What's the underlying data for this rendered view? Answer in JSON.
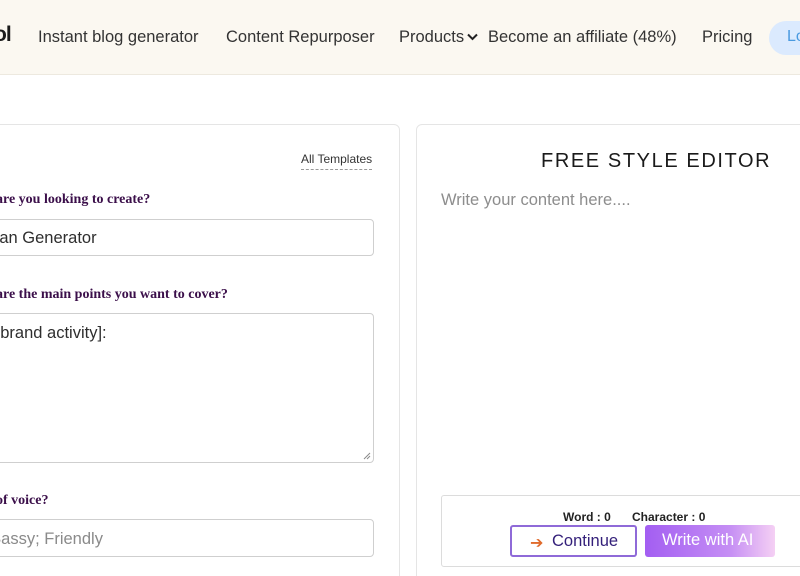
{
  "nav": {
    "logo_fragment": "ol",
    "links": [
      "Instant blog generator",
      "Content Repurposer",
      "Products",
      "Become an affiliate (48%)",
      "Pricing"
    ],
    "login_fragment": "Lo",
    "chevron_icon": "chevron-down-icon"
  },
  "form": {
    "all_templates": "All Templates",
    "q1": {
      "label": "are you looking to create?",
      "value": "ogan Generator"
    },
    "q2": {
      "label": "are the main points you want to cover?",
      "value": "ur brand activity]:"
    },
    "q3": {
      "label": "of voice?",
      "placeholder": ". Sassy; Friendly"
    }
  },
  "editor": {
    "title": "FREE STYLE EDITOR",
    "placeholder": "Write your content here....",
    "word_count": "Word : 0",
    "char_count": "Character : 0",
    "continue_label": "Continue",
    "continue_icon": "arrow-right-icon",
    "write_ai_label": "Write with AI"
  },
  "colors": {
    "nav_bg": "#fbf8f1",
    "label_purple": "#3b0f4a",
    "accent_purple": "#a35ef2",
    "login_bg": "#dbeafe"
  }
}
